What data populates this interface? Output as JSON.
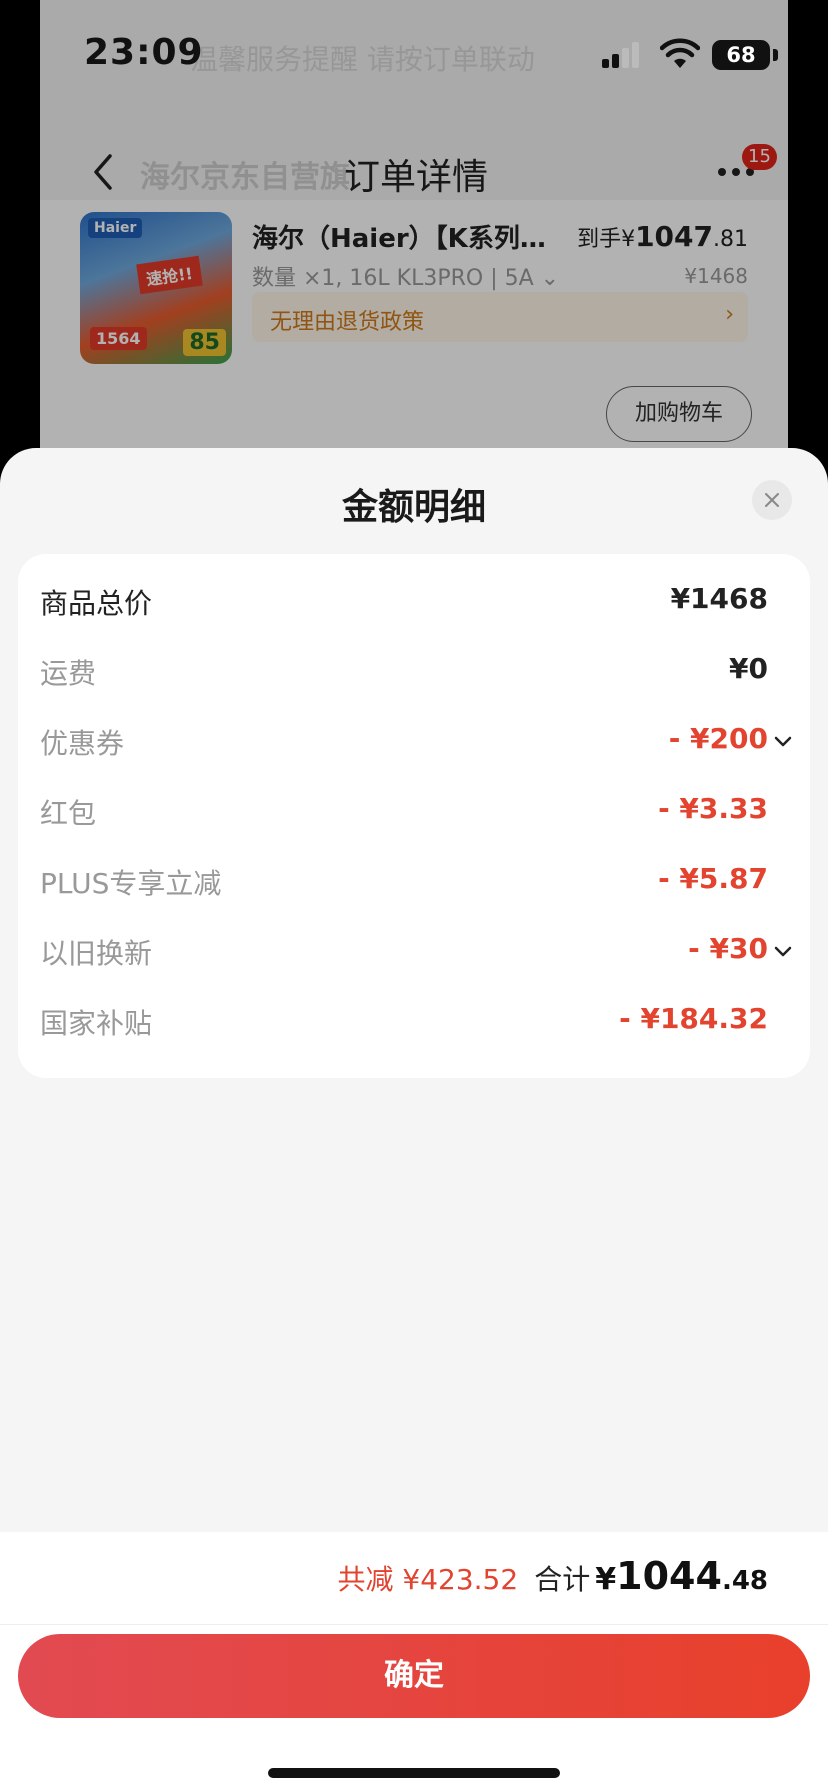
{
  "status_bar": {
    "time": "23:09",
    "battery": "68"
  },
  "background": {
    "notice_faded": "温馨服务提醒 请按订单联动",
    "store_name": "海尔京东自营旗",
    "page_title": "订单详情",
    "badge_count": "15",
    "product": {
      "thumb_brand": "Haier",
      "thumb_sticker": "速抢!!",
      "thumb_price": "1564",
      "thumb_rate": "85",
      "title": "海尔（Haier）【K系列…",
      "price_prefix": "到手¥",
      "price_int": "1047",
      "price_dec": ".81",
      "spec": "数量 ×1, 16L KL3PRO | 5A",
      "orig_price": "¥1468",
      "policy": "无理由退货政策",
      "policy_arrow": "›",
      "add_cart": "加购物车"
    }
  },
  "sheet": {
    "title": "金额明细",
    "rows": [
      {
        "label": "商品总价",
        "value": "¥1468"
      },
      {
        "label": "运费",
        "value": "¥0"
      },
      {
        "label": "优惠券",
        "value": "- ¥200"
      },
      {
        "label": "红包",
        "value": "- ¥3.33"
      },
      {
        "label": "PLUS专享立减",
        "value": "- ¥5.87"
      },
      {
        "label": "以旧换新",
        "value": "- ¥30"
      },
      {
        "label": "国家补贴",
        "value": "- ¥184.32"
      }
    ],
    "summary": {
      "saved": "共减 ¥423.52",
      "total_label": "合计",
      "total_symbol": "¥",
      "total_int": "1044",
      "total_dec": ".48"
    },
    "confirm": "确定"
  },
  "colors": {
    "accent": "#e2442f",
    "button_start": "#e24a52",
    "button_end": "#e8402b"
  }
}
